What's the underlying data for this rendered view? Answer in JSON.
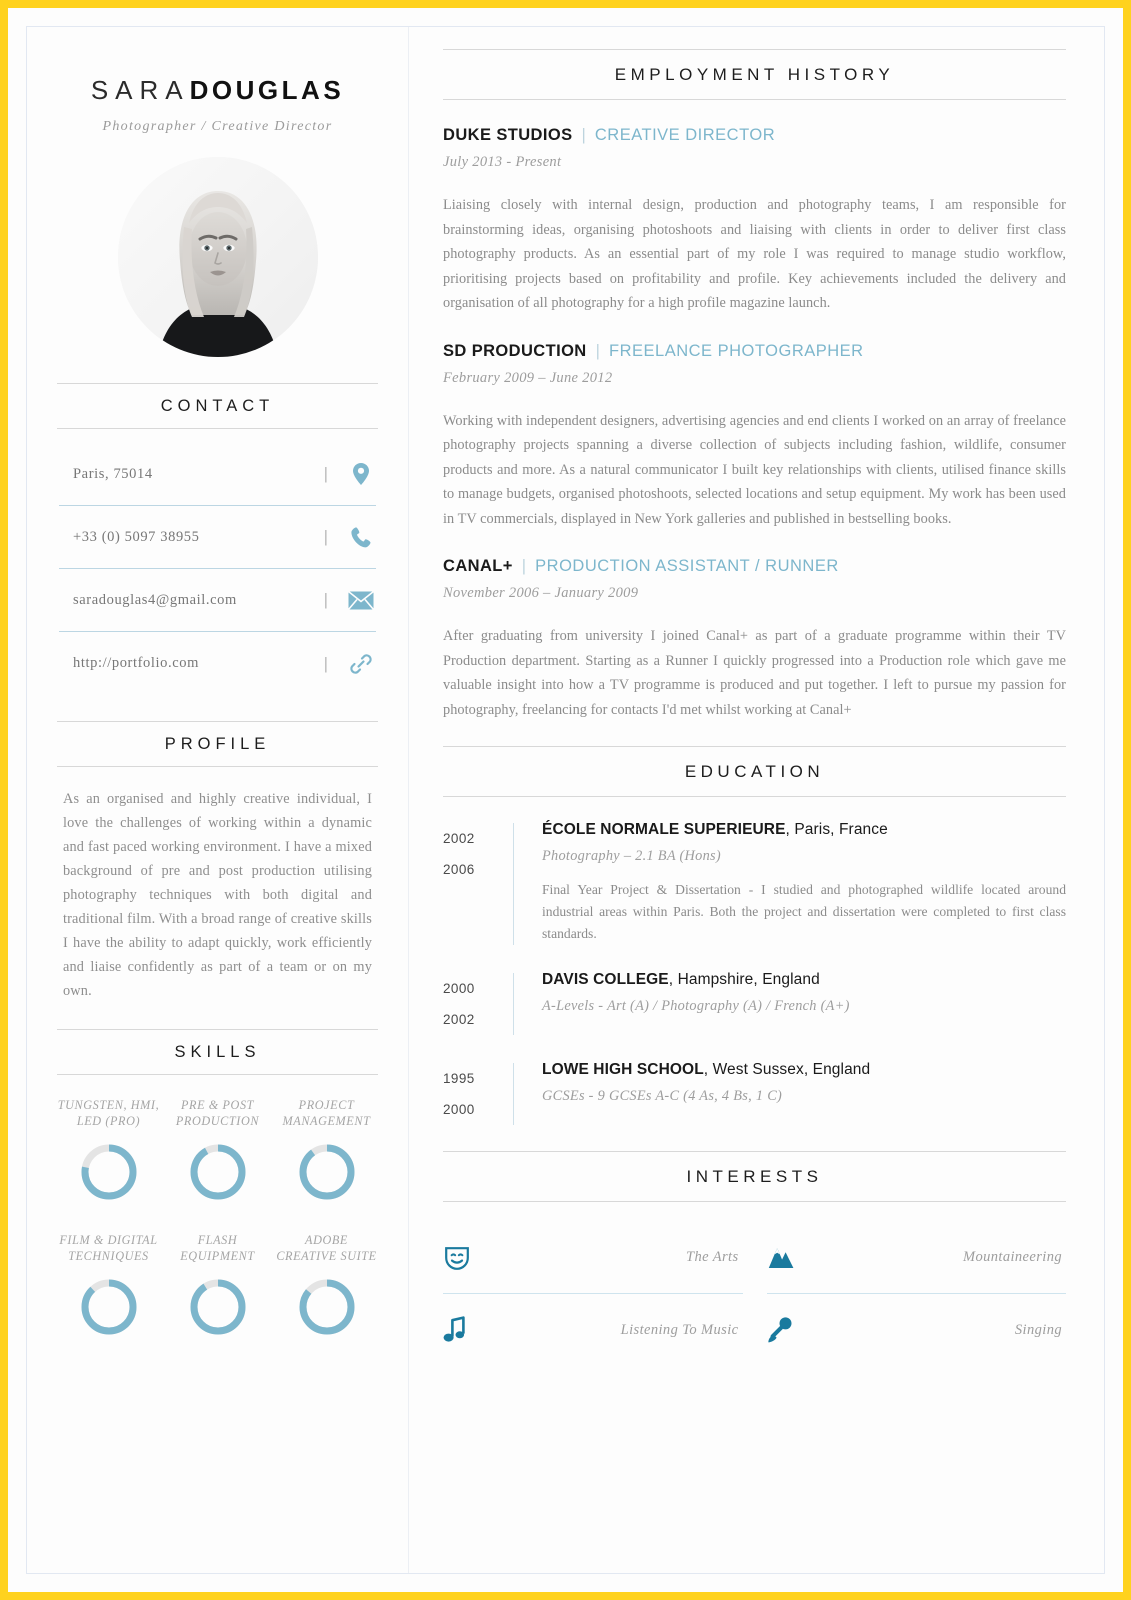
{
  "theme": {
    "frame_color": "#FFD21E",
    "accent_light": "#7db6cc",
    "accent_dark": "#1a7a9e",
    "rule_color": "#d8d8d8"
  },
  "header": {
    "first_name": "SARA",
    "last_name": "DOUGLAS",
    "tagline": "Photographer / Creative Director",
    "photo_alt": "portrait-photo"
  },
  "contact": {
    "heading": "CONTACT",
    "items": [
      {
        "value": "Paris, 75014",
        "icon": "location-pin-icon"
      },
      {
        "value": "+33 (0) 5097 38955",
        "icon": "phone-icon"
      },
      {
        "value": "saradouglas4@gmail.com",
        "icon": "envelope-icon"
      },
      {
        "value": "http://portfolio.com",
        "icon": "link-icon"
      }
    ]
  },
  "profile": {
    "heading": "PROFILE",
    "text": "As an organised and highly creative individual, I love the challenges of working within a dynamic and fast paced working environment. I have a mixed background of pre and post production utilising photography techniques with both digital and traditional film. With a broad range of creative skills I have the ability to adapt quickly, work efficiently and liaise confidently as part of a team or on my own."
  },
  "skills": {
    "heading": "SKILLS",
    "items": [
      {
        "label": "TUNGSTEN, HMI, LED (PRO)",
        "percent": 78
      },
      {
        "label": "PRE & POST PRODUCTION",
        "percent": 92
      },
      {
        "label": "PROJECT MANAGEMENT",
        "percent": 90
      },
      {
        "label": "FILM & DIGITAL TECHNIQUES",
        "percent": 88
      },
      {
        "label": "FLASH EQUIPMENT",
        "percent": 91
      },
      {
        "label": "ADOBE CREATIVE SUITE",
        "percent": 86
      }
    ]
  },
  "employment": {
    "heading": "EMPLOYMENT HISTORY",
    "jobs": [
      {
        "company": "DUKE STUDIOS",
        "separator": "|",
        "role": "CREATIVE DIRECTOR",
        "dates": "July 2013 - Present",
        "description": "Liaising closely with internal design, production and photography teams, I am responsible for brainstorming ideas, organising photoshoots and liaising with clients in order to deliver first class photography products.  As an essential part of my role I was required to manage studio workflow, prioritising projects based on profitability and profile.  Key achievements included the delivery and organisation of all photography for a high profile magazine launch."
      },
      {
        "company": "SD PRODUCTION",
        "separator": "|",
        "role": "FREELANCE PHOTOGRAPHER",
        "dates": "February 2009 – June 2012",
        "description": "Working with independent designers, advertising agencies and end clients I worked on an array of freelance photography projects spanning a diverse collection of subjects including fashion, wildlife, consumer products and more. As a natural communicator I built key relationships with clients, utilised finance skills to manage budgets, organised photoshoots, selected locations and setup equipment.   My work has been used in TV commercials, displayed in New York galleries and published in bestselling books."
      },
      {
        "company": "CANAL+",
        "separator": "|",
        "role": "PRODUCTION ASSISTANT / RUNNER",
        "dates": "November 2006 – January 2009",
        "description": "After graduating from university I joined Canal+ as part of a graduate programme within their TV Production department.  Starting as a Runner I quickly progressed into a Production role which gave me valuable insight into how a TV programme is produced and put together. I left to pursue my passion for photography, freelancing for contacts I'd met whilst working at Canal+"
      }
    ]
  },
  "education": {
    "heading": "EDUCATION",
    "entries": [
      {
        "start_year": "2002",
        "end_year": "2006",
        "school": "ÉCOLE NORMALE SUPERIEURE",
        "location": ", Paris, France",
        "qualification": "Photography – 2.1 BA (Hons)",
        "note": "Final Year Project & Dissertation - I studied and photographed wildlife located around industrial areas within Paris. Both the project and dissertation were completed to first class standards."
      },
      {
        "start_year": "2000",
        "end_year": "2002",
        "school": "DAVIS COLLEGE",
        "location": ", Hampshire, England",
        "qualification": "A-Levels - Art (A) / Photography (A) / French (A+)",
        "note": ""
      },
      {
        "start_year": "1995",
        "end_year": "2000",
        "school": "LOWE HIGH SCHOOL",
        "location": ", West Sussex, England",
        "qualification": "GCSEs - 9 GCSEs A-C (4 As, 4 Bs, 1 C)",
        "note": ""
      }
    ]
  },
  "interests": {
    "heading": "INTERESTS",
    "items": [
      {
        "label": "The Arts",
        "icon": "theatre-mask-icon"
      },
      {
        "label": "Mountaineering",
        "icon": "mountain-icon"
      },
      {
        "label": "Listening To Music",
        "icon": "music-note-icon"
      },
      {
        "label": "Singing",
        "icon": "microphone-icon"
      }
    ]
  }
}
